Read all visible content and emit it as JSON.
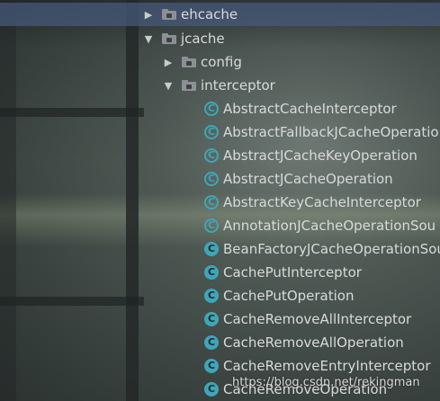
{
  "tree": {
    "folders": {
      "ehcache": "ehcache",
      "jcache": "jcache",
      "config": "config",
      "interceptor": "interceptor"
    },
    "class_icon_letter": "C",
    "classes": [
      "AbstractCacheInterceptor",
      "AbstractFallbackJCacheOperation",
      "AbstractJCacheKeyOperation",
      "AbstractJCacheOperation",
      "AbstractKeyCacheInterceptor",
      "AnnotationJCacheOperationSou",
      "BeanFactoryJCacheOperationSou",
      "CachePutInterceptor",
      "CachePutOperation",
      "CacheRemoveAllInterceptor",
      "CacheRemoveAllOperation",
      "CacheRemoveEntryInterceptor",
      "CacheRemoveOperation"
    ]
  },
  "watermark": "https://blog.csdn.net/rekingman",
  "colors": {
    "selection": "#465a7d",
    "class_icon": "#3fa6b8",
    "text": "#d8dadb"
  }
}
